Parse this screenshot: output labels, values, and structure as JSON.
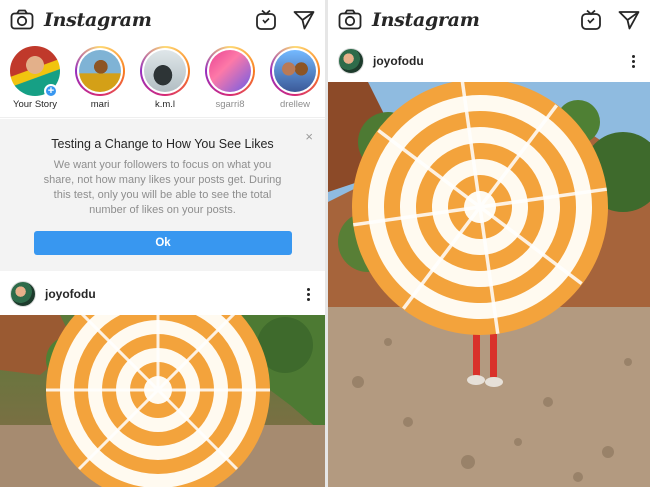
{
  "app": {
    "brand": "Instagram"
  },
  "stories": [
    {
      "label": "Your Story",
      "seen": false,
      "ring": "none",
      "colors": [
        "#c0392b",
        "#f1c40f"
      ]
    },
    {
      "label": "mari",
      "seen": false,
      "ring": "active",
      "colors": [
        "#7fb3d5",
        "#d4a017"
      ]
    },
    {
      "label": "k.m.l",
      "seen": false,
      "ring": "active",
      "colors": [
        "#dfe6e9",
        "#2d3436"
      ]
    },
    {
      "label": "sgarri8",
      "seen": true,
      "ring": "active",
      "colors": [
        "#e84393",
        "#6c5ce7"
      ]
    },
    {
      "label": "drellew",
      "seen": true,
      "ring": "active",
      "colors": [
        "#b97a57",
        "#3b5998"
      ]
    }
  ],
  "notice": {
    "close": "×",
    "title": "Testing a Change to How You See Likes",
    "body": "We want your followers to focus on what you share, not how many likes your posts get. During this test, only you will be able to see the total number of likes on your posts.",
    "button": "Ok"
  },
  "post": {
    "username": "joyofodu"
  },
  "colors": {
    "accent": "#3897f0",
    "umbrella": "#f0a94a"
  },
  "icons": {
    "camera": "camera-icon",
    "igtv": "igtv-icon",
    "direct": "direct-message-icon",
    "more": "more-options-icon"
  }
}
